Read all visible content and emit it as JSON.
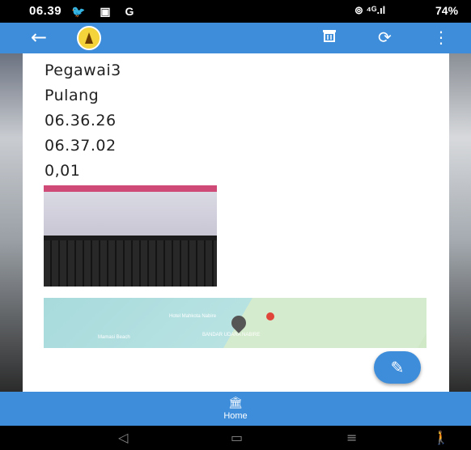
{
  "status_bar": {
    "time": "06.39",
    "notification_icons": [
      "twitter-icon",
      "calendar-icon",
      "google-icon"
    ],
    "signal": "⊚ ⁴ᴳ.ıl",
    "battery": "74%"
  },
  "app_bar": {
    "back_icon": "back-arrow-icon",
    "logo": "institution-logo",
    "actions": [
      "delete-icon",
      "refresh-icon",
      "more-vert-icon"
    ]
  },
  "record": {
    "name": "Pegawai3",
    "type": "Pulang",
    "time_in": "06.36.26",
    "time_out": "06.37.02",
    "distance": "0,01"
  },
  "map": {
    "labels": [
      "Hotel Mahkota Nabire",
      "Mamasi Beach",
      "BANDAR UDARA NABIRE"
    ]
  },
  "fab": {
    "icon": "edit-icon"
  },
  "bottom_nav": {
    "home_label": "Home",
    "home_icon": "bank-icon"
  },
  "system_nav": {
    "icons": [
      "back-triangle-icon",
      "home-rect-icon",
      "recents-lines-icon",
      "accessibility-icon"
    ]
  }
}
